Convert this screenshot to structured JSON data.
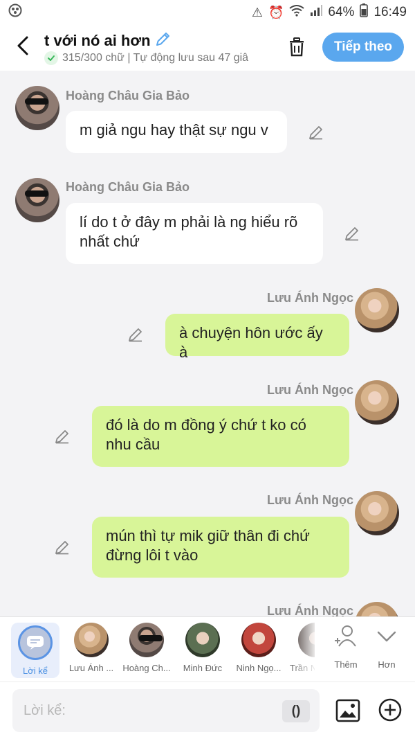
{
  "status": {
    "battery": "64%",
    "time": "16:49"
  },
  "header": {
    "title": "t với nó ai hơn",
    "subtitle": "315/300 chữ | Tự động lưu sau 47 giâ",
    "next_label": "Tiếp theo"
  },
  "messages": [
    {
      "sender": "Hoàng Châu Gia Bảo",
      "text": "m giả ngu hay thật sự ngu v",
      "side": "in"
    },
    {
      "sender": "Hoàng Châu Gia Bảo",
      "text": "lí do t ở đây m phải là ng hiểu rõ nhất chứ",
      "side": "in"
    },
    {
      "sender": "Lưu Ánh Ngọc",
      "text": "à chuyện hôn ước ấy à",
      "side": "out"
    },
    {
      "sender": "Lưu Ánh Ngọc",
      "text": "đó là do m đồng ý chứ t ko có nhu cầu",
      "side": "out"
    },
    {
      "sender": "Lưu Ánh Ngọc",
      "text": "mún thì tự mik giữ thân đi chứ đừng lôi t vào",
      "side": "out"
    },
    {
      "sender": "Lưu Ánh Ngọc",
      "text": "",
      "side": "out"
    }
  ],
  "characters": [
    {
      "label": "Lời kể"
    },
    {
      "label": "Lưu Ánh ..."
    },
    {
      "label": "Hoàng Ch..."
    },
    {
      "label": "Minh Đức"
    },
    {
      "label": "Ninh Ngọ..."
    },
    {
      "label": "Trần N"
    }
  ],
  "tools": {
    "add_label": "Thêm",
    "more_label": "Hơn"
  },
  "input": {
    "placeholder": "Lời kể:",
    "paren_label": "()"
  }
}
